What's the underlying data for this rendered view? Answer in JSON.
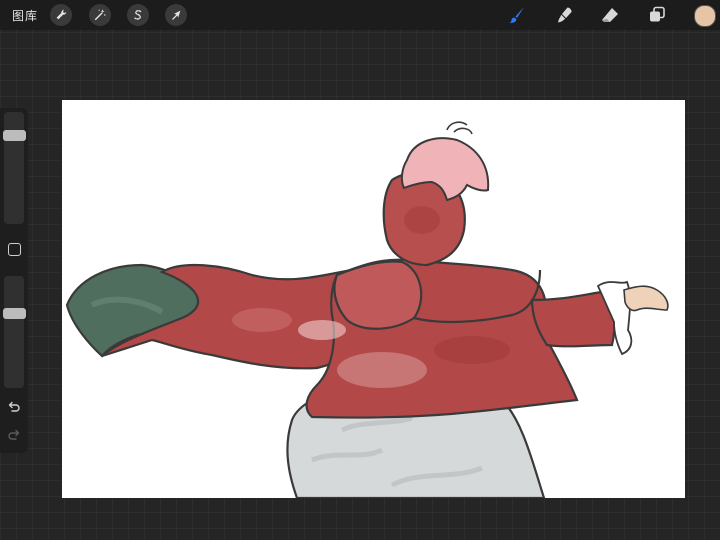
{
  "topbar": {
    "gallery_label": "图库",
    "actions": [
      {
        "icon": "wrench-icon",
        "name": "actions-button"
      },
      {
        "icon": "magic-wand-icon",
        "name": "adjustments-button"
      },
      {
        "icon": "selection-s-icon",
        "name": "selection-button"
      },
      {
        "icon": "arrow-cursor-icon",
        "name": "transform-button"
      }
    ],
    "tools": [
      {
        "icon": "brush-icon",
        "name": "brush-tool",
        "active": true
      },
      {
        "icon": "smudge-icon",
        "name": "smudge-tool",
        "active": false
      },
      {
        "icon": "eraser-icon",
        "name": "eraser-tool",
        "active": false
      },
      {
        "icon": "layers-icon",
        "name": "layers-button",
        "active": false
      }
    ],
    "current_color": "#e8c4a6"
  },
  "sidebar": {
    "size_level": 0.82,
    "opacity_level": 0.68,
    "undo_icon": "undo-icon",
    "redo_icon": "redo-icon"
  },
  "colors": {
    "accent": "#2f7bf6",
    "cloak_red": "#b34848",
    "cloak_green": "#4f6e5d",
    "skirt_gray": "#d6d9da",
    "hair_pink": "#f0b3b7",
    "skin": "#efd2ba",
    "ink": "#3a3a3a"
  }
}
